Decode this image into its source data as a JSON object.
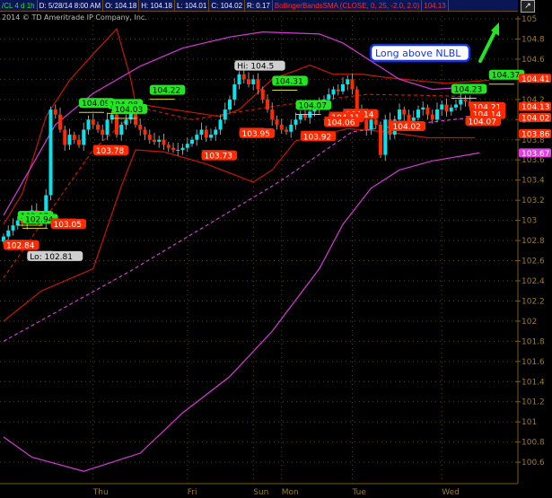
{
  "header": {
    "symbol": "/CL 4 d 1h",
    "date": "D: 5/28/14 8:00 AM",
    "open": "O: 104.18",
    "high": "H: 104.18",
    "low": "L: 104.01",
    "close": "C: 104.02",
    "range": "R: 0.17",
    "study": "BollingerBandsSMA (CLOSE, 0, 25, -2.0, 2.0)",
    "study_value": "104.13"
  },
  "copyright": "2014 © TD Ameritrade IP Company, Inc.",
  "annotation": "Long above NLBL",
  "colors": {
    "up": "#00e5ee",
    "down": "#ff2a00",
    "band_red": "#c41a00",
    "band_magenta": "#d63ad6",
    "green_label": "#22e622",
    "red_label": "#ff2a00",
    "header": "#0b1657"
  },
  "chart_data": {
    "type": "candlestick",
    "title": "/CL 4 d 1h",
    "ylim": [
      100.6,
      105
    ],
    "yticks": [
      105,
      104.8,
      104.6,
      104.4,
      104.2,
      104,
      103.8,
      103.6,
      103.4,
      103.2,
      103,
      102.8,
      102.6,
      102.4,
      102.2,
      102,
      101.8,
      101.6,
      101.4,
      101.2,
      101,
      100.8,
      100.6
    ],
    "xticks": [
      {
        "label": "Thu",
        "bar": 19
      },
      {
        "label": "Fri",
        "bar": 39
      },
      {
        "label": "Sun",
        "bar": 53
      },
      {
        "label": "Mon",
        "bar": 59
      },
      {
        "label": "Tue",
        "bar": 74
      },
      {
        "label": "Wed",
        "bar": 93
      }
    ],
    "closes": [
      102.84,
      102.9,
      102.95,
      103.0,
      102.97,
      103.05,
      103.1,
      103.0,
      102.98,
      103.25,
      104.1,
      104.05,
      103.9,
      103.75,
      103.85,
      103.8,
      103.75,
      103.9,
      104.0,
      103.95,
      103.9,
      103.85,
      104.0,
      104.05,
      103.85,
      103.95,
      104.0,
      104.08,
      103.95,
      103.9,
      103.85,
      103.8,
      103.78,
      103.8,
      103.75,
      103.72,
      103.7,
      103.7,
      103.72,
      103.76,
      103.8,
      103.85,
      103.9,
      103.82,
      103.85,
      103.9,
      104.0,
      104.1,
      104.2,
      104.35,
      104.45,
      104.4,
      104.35,
      104.4,
      104.3,
      104.2,
      104.1,
      104.0,
      103.95,
      103.9,
      103.88,
      103.95,
      104.0,
      104.05,
      104.02,
      104.08,
      104.1,
      104.15,
      104.2,
      104.25,
      104.3,
      104.28,
      104.35,
      104.4,
      104.3,
      104.1,
      104.0,
      103.9,
      104.0,
      103.95,
      103.65,
      104.0,
      103.85,
      104.0,
      104.1,
      104.05,
      103.98,
      104.02,
      104.1,
      104.12,
      104.05,
      104.0,
      104.1,
      104.15,
      104.08,
      104.12,
      104.15,
      104.2,
      104.18,
      104.13
    ],
    "bands": [
      {
        "name": "red-upper",
        "color": "#c41a00",
        "dash": false,
        "points": [
          [
            0,
            102.96
          ],
          [
            4,
            103.27
          ],
          [
            9,
            104.03
          ],
          [
            14,
            104.39
          ],
          [
            19,
            104.65
          ],
          [
            24,
            104.9
          ],
          [
            27,
            104.4
          ],
          [
            28,
            104.16
          ],
          [
            36,
            104.1
          ],
          [
            46,
            104.03
          ],
          [
            50,
            104.1
          ],
          [
            57,
            104.4
          ],
          [
            65,
            104.54
          ],
          [
            70,
            104.45
          ],
          [
            76,
            104.45
          ],
          [
            81,
            104.42
          ],
          [
            89,
            104.38
          ],
          [
            94,
            104.36
          ],
          [
            103,
            104.39
          ]
        ]
      },
      {
        "name": "red-lower",
        "color": "#c41a00",
        "dash": false,
        "points": [
          [
            0,
            102.0
          ],
          [
            8,
            102.3
          ],
          [
            19,
            102.52
          ],
          [
            25,
            103.34
          ],
          [
            28,
            103.7
          ],
          [
            34,
            103.68
          ],
          [
            43,
            103.56
          ],
          [
            48,
            103.47
          ],
          [
            53,
            103.38
          ],
          [
            57,
            103.5
          ],
          [
            62,
            103.79
          ],
          [
            73,
            103.91
          ],
          [
            81,
            103.88
          ],
          [
            90,
            103.82
          ],
          [
            100,
            103.82
          ]
        ]
      },
      {
        "name": "red-mid",
        "color": "#c41a00",
        "dash": true,
        "points": [
          [
            0,
            102.43
          ],
          [
            19,
            103.7
          ],
          [
            29,
            104.12
          ],
          [
            40,
            104.0
          ],
          [
            57,
            104.13
          ],
          [
            65,
            104.18
          ],
          [
            77,
            104.25
          ],
          [
            90,
            104.24
          ],
          [
            97,
            104.23
          ]
        ]
      },
      {
        "name": "magenta-upper",
        "color": "#d63ad6",
        "dash": false,
        "points": [
          [
            0,
            103.05
          ],
          [
            11,
            103.95
          ],
          [
            19,
            104.26
          ],
          [
            29,
            104.53
          ],
          [
            38,
            104.71
          ],
          [
            48,
            104.82
          ],
          [
            55,
            104.87
          ],
          [
            67,
            104.85
          ],
          [
            72,
            104.76
          ],
          [
            78,
            104.58
          ],
          [
            84,
            104.4
          ],
          [
            91,
            104.3
          ],
          [
            101,
            104.33
          ]
        ]
      },
      {
        "name": "magenta-lower",
        "color": "#d63ad6",
        "dash": false,
        "points": [
          [
            0,
            100.85
          ],
          [
            6,
            100.65
          ],
          [
            17,
            100.51
          ],
          [
            29,
            100.69
          ],
          [
            38,
            101.09
          ],
          [
            48,
            101.45
          ],
          [
            57,
            101.9
          ],
          [
            67,
            102.52
          ],
          [
            72,
            102.96
          ],
          [
            78,
            103.32
          ],
          [
            84,
            103.5
          ],
          [
            91,
            103.59
          ],
          [
            101,
            103.67
          ]
        ]
      },
      {
        "name": "magenta-mid",
        "color": "#d63ad6",
        "dash": true,
        "points": [
          [
            0,
            101.8
          ],
          [
            27,
            102.5
          ],
          [
            57,
            103.34
          ],
          [
            60,
            103.43
          ],
          [
            74,
            103.88
          ],
          [
            84,
            103.94
          ],
          [
            101,
            104.03
          ]
        ]
      }
    ],
    "labels": [
      {
        "text": "104.09",
        "kind": "green",
        "bar": 16
      },
      {
        "text": "104.08",
        "kind": "green",
        "bar": 22
      },
      {
        "text": "104.03",
        "kind": "green",
        "bar": 23
      },
      {
        "text": "104.22",
        "kind": "green",
        "bar": 31
      },
      {
        "text": "102.97",
        "kind": "green",
        "bar": 3
      },
      {
        "text": "102.94",
        "kind": "green",
        "bar": 4
      },
      {
        "text": "104.31",
        "kind": "green",
        "bar": 57
      },
      {
        "text": "104.07",
        "kind": "green",
        "bar": 62
      },
      {
        "text": "104.23",
        "kind": "green",
        "bar": 95
      },
      {
        "text": "104.37",
        "kind": "green",
        "bar": 103
      },
      {
        "text": "102.84",
        "kind": "red",
        "bar": 0
      },
      {
        "text": "103.05",
        "kind": "red",
        "bar": 10
      },
      {
        "text": "103.78",
        "kind": "red",
        "bar": 19
      },
      {
        "text": "103.73",
        "kind": "red",
        "bar": 42
      },
      {
        "text": "103.95",
        "kind": "red",
        "bar": 50
      },
      {
        "text": "103.92",
        "kind": "red",
        "bar": 63
      },
      {
        "text": "104.14",
        "kind": "red",
        "bar": 72
      },
      {
        "text": "104.11",
        "kind": "red",
        "bar": 69
      },
      {
        "text": "104.06",
        "kind": "red",
        "bar": 68
      },
      {
        "text": "104.02",
        "kind": "red",
        "bar": 82
      },
      {
        "text": "104.21",
        "kind": "red",
        "bar": 99
      },
      {
        "text": "104.14",
        "kind": "red",
        "bar": 99
      },
      {
        "text": "104.07",
        "kind": "red",
        "bar": 98
      },
      {
        "text": "Hi: 104.5",
        "kind": "gray",
        "bar": 49,
        "price": 104.62
      },
      {
        "text": "Lo: 102.81",
        "kind": "gray",
        "bar": 5,
        "price": 102.73
      }
    ],
    "axis_tags": [
      {
        "text": "104.41",
        "color": "#ff2a00"
      },
      {
        "text": "104.13",
        "color": "#ff2a00"
      },
      {
        "text": "104.02",
        "color": "#ff2a00"
      },
      {
        "text": "103.86",
        "color": "#ff2a00"
      },
      {
        "text": "103.67",
        "color": "#e040e0"
      }
    ]
  }
}
